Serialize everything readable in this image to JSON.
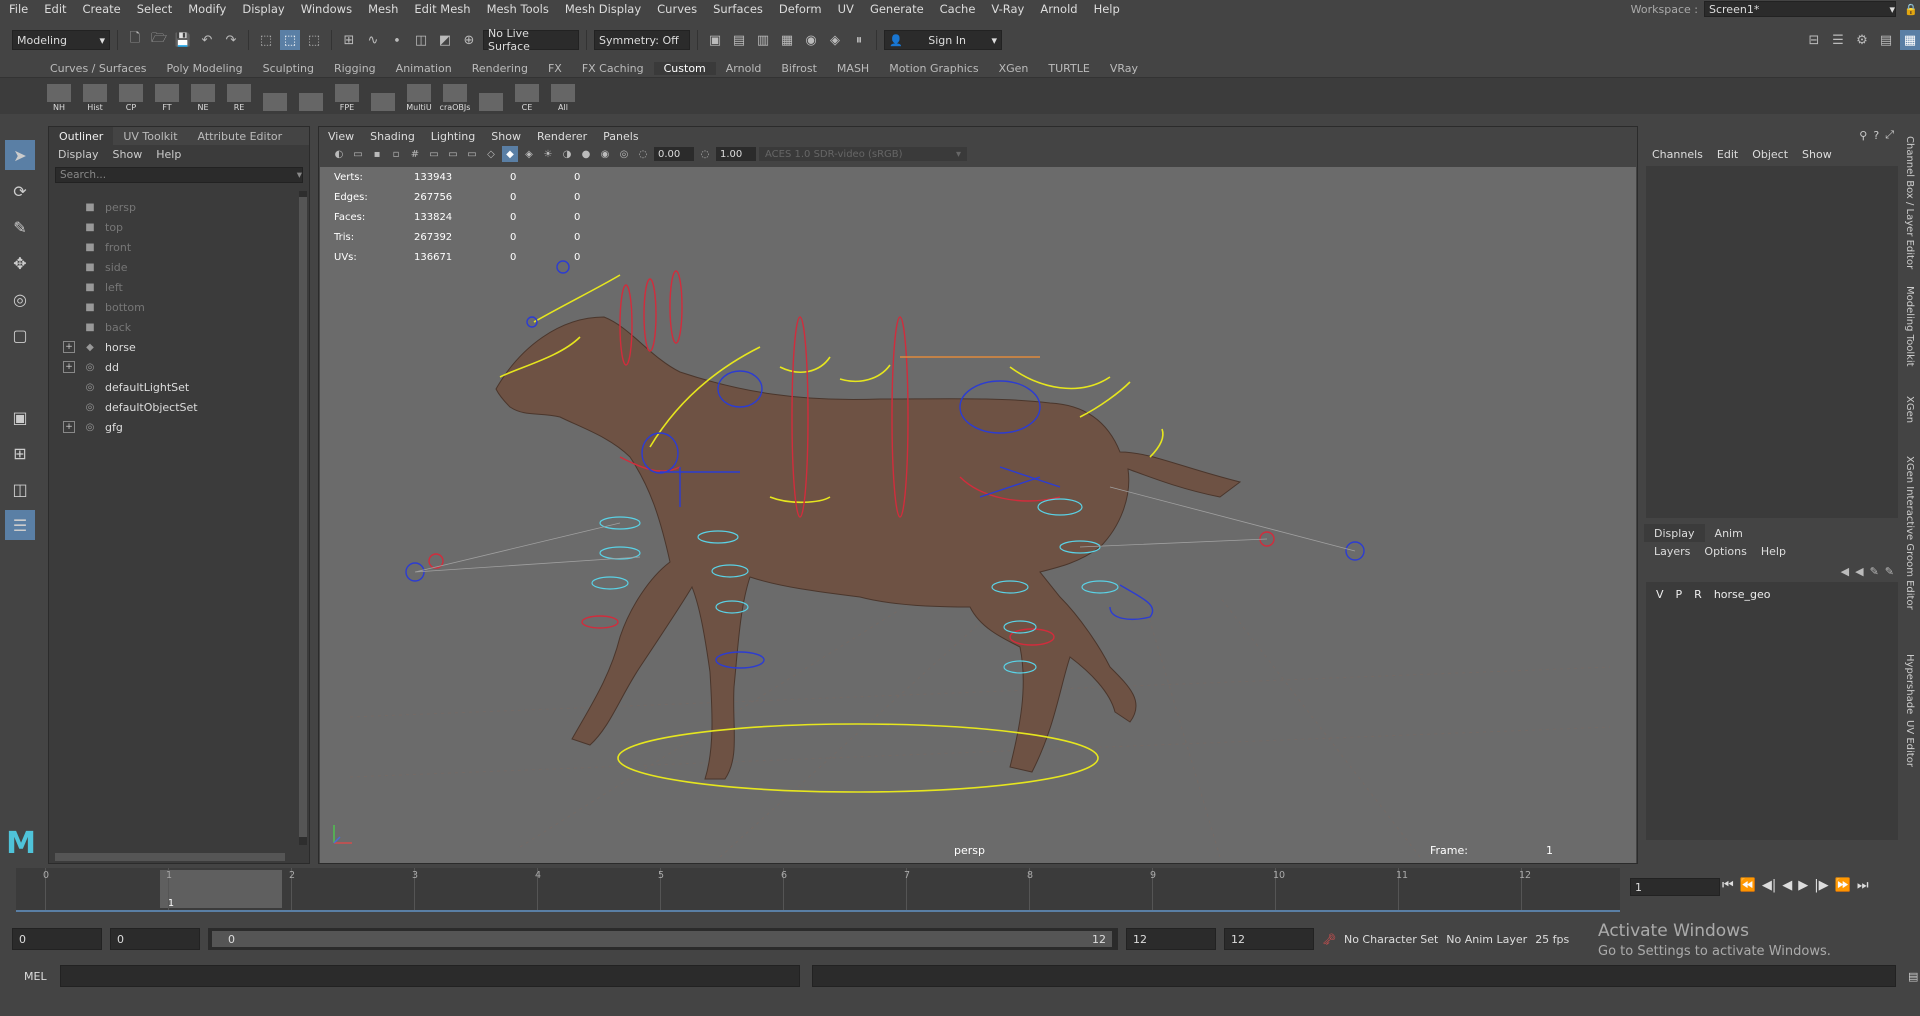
{
  "menu": [
    "File",
    "Edit",
    "Create",
    "Select",
    "Modify",
    "Display",
    "Windows",
    "Mesh",
    "Edit Mesh",
    "Mesh Tools",
    "Mesh Display",
    "Curves",
    "Surfaces",
    "Deform",
    "UV",
    "Generate",
    "Cache",
    "V-Ray",
    "Arnold",
    "Help"
  ],
  "workspace": {
    "label": "Workspace :",
    "value": "Screen1*"
  },
  "statusline": {
    "mode": "Modeling",
    "live_surface": "No Live Surface",
    "symmetry": "Symmetry: Off",
    "sign_in": "Sign In"
  },
  "shelf_tabs": [
    "Curves / Surfaces",
    "Poly Modeling",
    "Sculpting",
    "Rigging",
    "Animation",
    "Rendering",
    "FX",
    "FX Caching",
    "Custom",
    "Arnold",
    "Bifrost",
    "MASH",
    "Motion Graphics",
    "XGen",
    "TURTLE",
    "VRay"
  ],
  "active_shelf_tab": "Custom",
  "shelf_buttons": [
    "NH",
    "Hist",
    "CP",
    "FT",
    "NE",
    "RE",
    "",
    "",
    "FPE",
    "",
    "MultiU",
    "craOBJs",
    "",
    "CE",
    "All"
  ],
  "outliner": {
    "tabs": [
      "Outliner",
      "UV Toolkit",
      "Attribute Editor"
    ],
    "menu": [
      "Display",
      "Show",
      "Help"
    ],
    "search_placeholder": "Search...",
    "items": [
      {
        "label": "persp",
        "type": "camera",
        "dim": true,
        "expandable": false
      },
      {
        "label": "top",
        "type": "camera",
        "dim": true,
        "expandable": false
      },
      {
        "label": "front",
        "type": "camera",
        "dim": true,
        "expandable": false
      },
      {
        "label": "side",
        "type": "camera",
        "dim": true,
        "expandable": false
      },
      {
        "label": "left",
        "type": "camera",
        "dim": true,
        "expandable": false
      },
      {
        "label": "bottom",
        "type": "camera",
        "dim": true,
        "expandable": false
      },
      {
        "label": "back",
        "type": "camera",
        "dim": true,
        "expandable": false
      },
      {
        "label": "horse",
        "type": "mesh",
        "dim": false,
        "expandable": true
      },
      {
        "label": "dd",
        "type": "set",
        "dim": false,
        "expandable": true
      },
      {
        "label": "defaultLightSet",
        "type": "set",
        "dim": false,
        "expandable": false
      },
      {
        "label": "defaultObjectSet",
        "type": "set",
        "dim": false,
        "expandable": false
      },
      {
        "label": "gfg",
        "type": "set",
        "dim": false,
        "expandable": true
      }
    ]
  },
  "viewport": {
    "menu": [
      "View",
      "Shading",
      "Lighting",
      "Show",
      "Renderer",
      "Panels"
    ],
    "near": "0.00",
    "far": "1.00",
    "color_space": "ACES 1.0 SDR-video (sRGB)",
    "hud": [
      {
        "label": "Verts:",
        "value": "133943",
        "a": "0",
        "b": "0"
      },
      {
        "label": "Edges:",
        "value": "267756",
        "a": "0",
        "b": "0"
      },
      {
        "label": "Faces:",
        "value": "133824",
        "a": "0",
        "b": "0"
      },
      {
        "label": "Tris:",
        "value": "267392",
        "a": "0",
        "b": "0"
      },
      {
        "label": "UVs:",
        "value": "136671",
        "a": "0",
        "b": "0"
      }
    ],
    "camera": "persp",
    "frame_label": "Frame:",
    "frame_value": "1",
    "colors": {
      "bg": "#6b6b6b",
      "horse": "#6e5244",
      "ctrl_yellow": "#e6e61e",
      "ctrl_red": "#d22c3c",
      "ctrl_blue": "#2c3cd2",
      "ctrl_cyan": "#5ad2e6"
    }
  },
  "channelbox": {
    "menu": [
      "Channels",
      "Edit",
      "Object",
      "Show"
    ],
    "layer_tabs": [
      "Display",
      "Anim"
    ],
    "layer_menu": [
      "Layers",
      "Options",
      "Help"
    ],
    "layer": {
      "v": "V",
      "p": "P",
      "r": "R",
      "name": "horse_geo"
    }
  },
  "side_tabs": [
    "Channel Box / Layer Editor",
    "Modeling Toolkit",
    "XGen",
    "XGen Interactive Groom Editor",
    "Hypershade",
    "UV Editor"
  ],
  "timeslider": {
    "ticks": [
      "0",
      "1",
      "2",
      "3",
      "4",
      "5",
      "6",
      "7",
      "8",
      "9",
      "10",
      "11",
      "12"
    ],
    "current": "1",
    "current_frame_field": "1"
  },
  "range": {
    "start": "0",
    "anim_start": "0",
    "range_left": "0",
    "range_right": "12",
    "anim_end": "12",
    "end": "12",
    "character_set": "No Character Set",
    "anim_layer": "No Anim Layer",
    "fps": "25 fps"
  },
  "cmdline": {
    "label": "MEL"
  },
  "watermark": {
    "line1": "Activate Windows",
    "line2": "Go to Settings to activate Windows."
  }
}
